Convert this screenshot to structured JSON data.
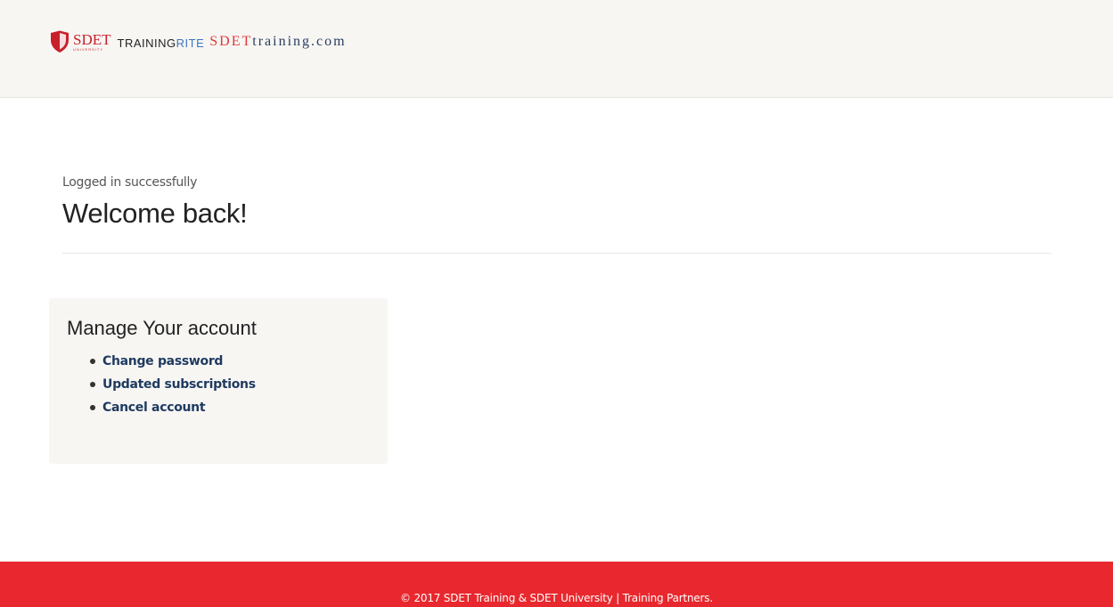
{
  "header": {
    "logos": {
      "sdet_university": {
        "main": "SDET",
        "sub": "UNIVERSITY",
        "icon": "shield-icon",
        "color": "#c8202b"
      },
      "trainingrite": {
        "part1": "TRAINING",
        "part2": "RITE"
      },
      "sdettraining": {
        "part1": "SDET",
        "part2": "training.com"
      }
    },
    "background": "#f7f6f3"
  },
  "main": {
    "status": "Logged in successfully",
    "title": "Welcome back!"
  },
  "account_panel": {
    "title": "Manage Your account",
    "links": [
      {
        "label": "Change password"
      },
      {
        "label": "Updated subscriptions"
      },
      {
        "label": "Cancel account"
      }
    ]
  },
  "footer": {
    "copyright": "© 2017 SDET Training & SDET University | Training Partners.",
    "background": "#e8282e"
  }
}
